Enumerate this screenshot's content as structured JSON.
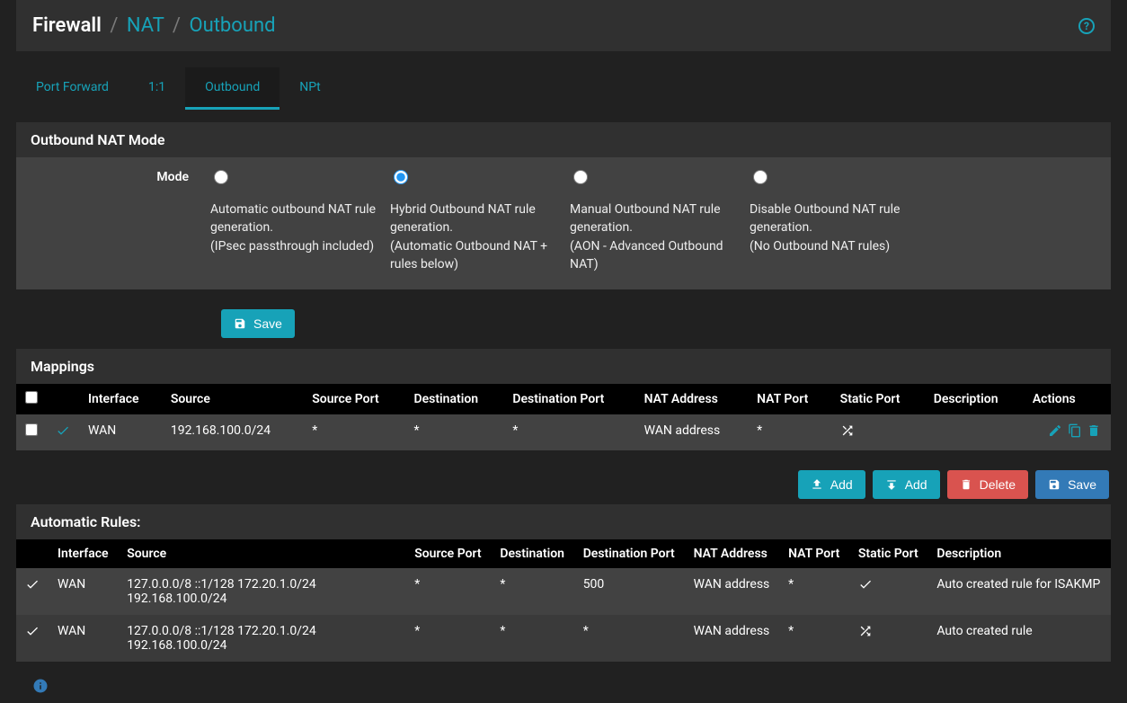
{
  "breadcrumb": {
    "root": "Firewall",
    "l1": "NAT",
    "l2": "Outbound",
    "sep": "/"
  },
  "help_glyph": "?",
  "tabs": [
    "Port Forward",
    "1:1",
    "Outbound",
    "NPt"
  ],
  "mode_panel": {
    "title": "Outbound NAT Mode",
    "label": "Mode",
    "options": [
      {
        "line1": "Automatic outbound NAT rule generation.",
        "line2": "(IPsec passthrough included)",
        "checked": false
      },
      {
        "line1": "Hybrid Outbound NAT rule generation.",
        "line2": "(Automatic Outbound NAT + rules below)",
        "checked": true
      },
      {
        "line1": "Manual Outbound NAT rule generation.",
        "line2": "(AON - Advanced Outbound NAT)",
        "checked": false
      },
      {
        "line1": "Disable Outbound NAT rule generation.",
        "line2": "(No Outbound NAT rules)",
        "checked": false
      }
    ],
    "save": "Save"
  },
  "mappings": {
    "title": "Mappings",
    "headers": [
      "",
      "",
      "Interface",
      "Source",
      "Source Port",
      "Destination",
      "Destination Port",
      "NAT Address",
      "NAT Port",
      "Static Port",
      "Description",
      "Actions"
    ],
    "rows": [
      {
        "interface": "WAN",
        "source": "192.168.100.0/24",
        "sport": "*",
        "dest": "*",
        "dport": "*",
        "nat_addr": "WAN address",
        "nat_port": "*",
        "static_port": "shuffle",
        "desc": ""
      }
    ],
    "buttons": {
      "add_up": "Add",
      "add_down": "Add",
      "delete": "Delete",
      "save": "Save"
    }
  },
  "auto_rules": {
    "title": "Automatic Rules:",
    "headers": [
      "",
      "Interface",
      "Source",
      "Source Port",
      "Destination",
      "Destination Port",
      "NAT Address",
      "NAT Port",
      "Static Port",
      "Description"
    ],
    "rows": [
      {
        "interface": "WAN",
        "source": "127.0.0.0/8 ::1/128 172.20.1.0/24 192.168.100.0/24",
        "sport": "*",
        "dest": "*",
        "dport": "500",
        "nat_addr": "WAN address",
        "nat_port": "*",
        "static_port": "check",
        "desc": "Auto created rule for ISAKMP"
      },
      {
        "interface": "WAN",
        "source": "127.0.0.0/8 ::1/128 172.20.1.0/24 192.168.100.0/24",
        "sport": "*",
        "dest": "*",
        "dport": "*",
        "nat_addr": "WAN address",
        "nat_port": "*",
        "static_port": "shuffle",
        "desc": "Auto created rule"
      }
    ]
  }
}
